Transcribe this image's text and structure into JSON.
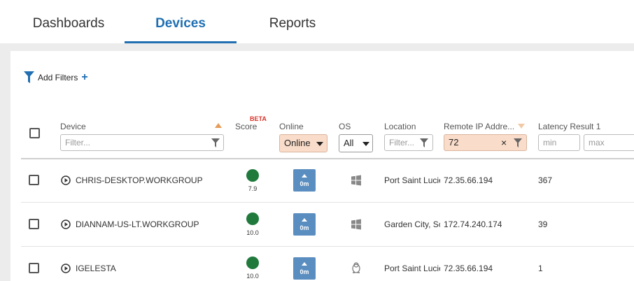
{
  "tabs": [
    {
      "label": "Dashboards",
      "active": false
    },
    {
      "label": "Devices",
      "active": true
    },
    {
      "label": "Reports",
      "active": false
    }
  ],
  "toolbar": {
    "add_filters_label": "Add Filters",
    "add_icon": "+"
  },
  "columns": {
    "device": {
      "label": "Device",
      "filter_placeholder": "Filter...",
      "sort": "ascending"
    },
    "score": {
      "label": "Score",
      "badge": "BETA"
    },
    "online": {
      "label": "Online",
      "selected": "Online"
    },
    "os": {
      "label": "OS",
      "selected": "All"
    },
    "location": {
      "label": "Location",
      "filter_placeholder": "Filter..."
    },
    "remote_ip": {
      "label": "Remote IP Addre...",
      "filter_value": "72",
      "clear_icon": "×"
    },
    "latency": {
      "label": "Latency Result 1",
      "min_placeholder": "min",
      "max_placeholder": "max"
    }
  },
  "rows": [
    {
      "device": "CHRIS-DESKTOP.WORKGROUP",
      "score": "7.9",
      "online": "0m",
      "os": "windows-icon",
      "location": "Port Saint Lucie",
      "remote_ip": "72.35.66.194",
      "latency": "367"
    },
    {
      "device": "DIANNAM-US-LT.WORKGROUP",
      "score": "10.0",
      "online": "0m",
      "os": "windows-icon",
      "location": "Garden City, Sc",
      "remote_ip": "172.74.240.174",
      "latency": "39"
    },
    {
      "device": "IGELESTA",
      "score": "10.0",
      "online": "0m",
      "os": "linux-icon",
      "location": "Port Saint Lucie",
      "remote_ip": "72.35.66.194",
      "latency": "1"
    }
  ],
  "colors": {
    "accent": "#1f6fb2",
    "score_good": "#1f7a3c",
    "online_button": "#5b8ec0",
    "active_filter": "#f9dcc9",
    "beta": "#d9352a"
  }
}
